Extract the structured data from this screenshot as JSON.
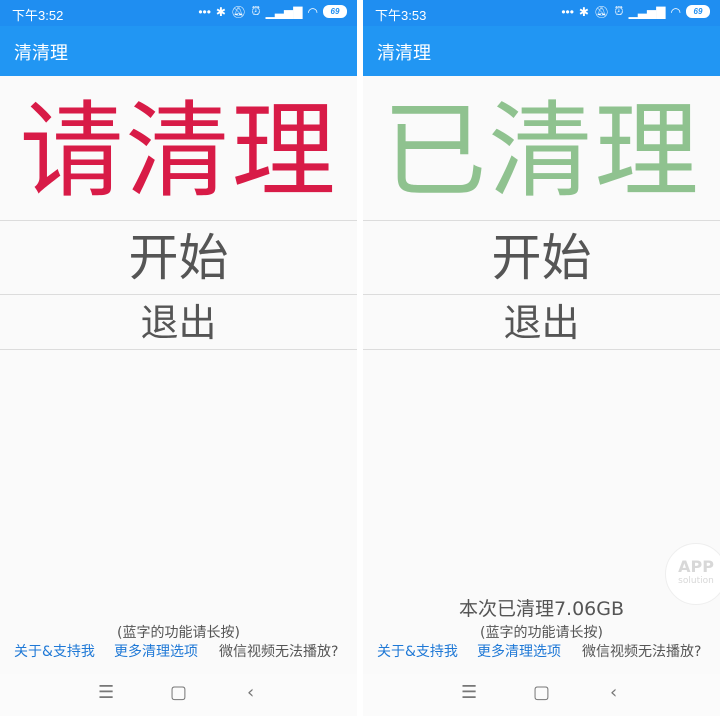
{
  "left": {
    "statusbar": {
      "time": "下午3:52",
      "battery": "69"
    },
    "appbar": {
      "title": "清清理"
    },
    "status_text": "请清理",
    "start_label": "开始",
    "exit_label": "退出",
    "hint": "(蓝字的功能请长按)",
    "links": {
      "about": "关于&支持我",
      "more": "更多清理选项",
      "video": "微信视频无法播放?"
    },
    "nav": {
      "menu": "☰",
      "home": "▢",
      "back": "‹"
    }
  },
  "right": {
    "statusbar": {
      "time": "下午3:53",
      "battery": "69"
    },
    "appbar": {
      "title": "清清理"
    },
    "status_text": "已清理",
    "start_label": "开始",
    "exit_label": "退出",
    "result": "本次已清理7.06GB",
    "hint": "(蓝字的功能请长按)",
    "links": {
      "about": "关于&支持我",
      "more": "更多清理选项",
      "video": "微信视频无法播放?"
    },
    "nav": {
      "menu": "☰",
      "home": "▢",
      "back": "‹"
    },
    "watermark": {
      "line1": "APP",
      "line2": "solution"
    }
  },
  "colors": {
    "appbar": "#2196f3",
    "status_pending": "#d81b47",
    "status_done": "#8fc28f",
    "link": "#1e78d6"
  }
}
